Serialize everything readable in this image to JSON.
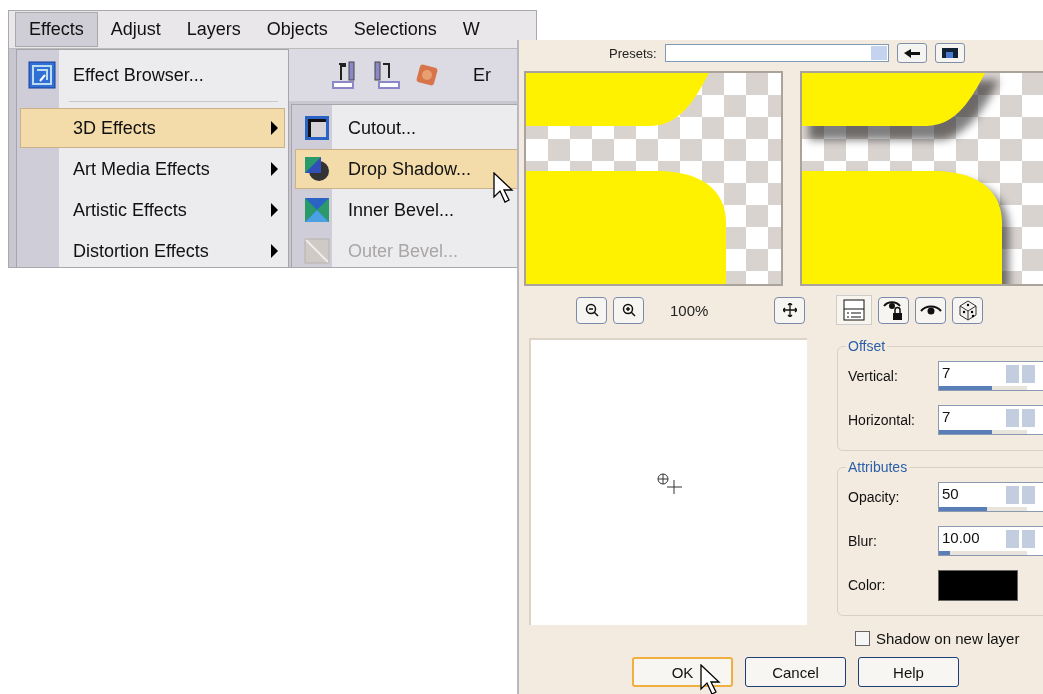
{
  "menu_bar": {
    "items": [
      {
        "label": "Effects",
        "selected": true
      },
      {
        "label": "Adjust",
        "selected": false
      },
      {
        "label": "Layers",
        "selected": false
      },
      {
        "label": "Objects",
        "selected": false
      },
      {
        "label": "Selections",
        "selected": false
      },
      {
        "label": "W",
        "selected": false
      }
    ]
  },
  "toolbar": {
    "text": "Er"
  },
  "effects_menu": {
    "items": [
      {
        "kind": "item",
        "label": "Effect Browser...",
        "selected": false,
        "submenu": false
      },
      {
        "kind": "separator"
      },
      {
        "kind": "item",
        "label": "3D Effects",
        "selected": true,
        "submenu": true
      },
      {
        "kind": "item",
        "label": "Art Media Effects",
        "selected": false,
        "submenu": true
      },
      {
        "kind": "item",
        "label": "Artistic Effects",
        "selected": false,
        "submenu": true
      },
      {
        "kind": "item",
        "label": "Distortion Effects",
        "selected": false,
        "submenu": true
      }
    ]
  },
  "submenu": {
    "items": [
      {
        "label": "Cutout...",
        "selected": false,
        "disabled": false
      },
      {
        "label": "Drop Shadow...",
        "selected": true,
        "disabled": false
      },
      {
        "label": "Inner Bevel...",
        "selected": false,
        "disabled": false
      },
      {
        "label": "Outer Bevel...",
        "selected": false,
        "disabled": true
      }
    ]
  },
  "dialog": {
    "presets_label": "Presets:",
    "zoom": "100%",
    "offset": {
      "title": "Offset",
      "fields": [
        {
          "label": "Vertical:",
          "value": "7",
          "level": 0.6
        },
        {
          "label": "Horizontal:",
          "value": "7",
          "level": 0.6
        }
      ]
    },
    "attributes": {
      "title": "Attributes",
      "fields": [
        {
          "label": "Opacity:",
          "value": "50",
          "level": 0.55
        },
        {
          "label": "Blur:",
          "value": "10.00",
          "level": 0.12
        }
      ],
      "color_label": "Color:",
      "color": "#000000"
    },
    "shadow_on_new_layer": {
      "label": "Shadow on new layer",
      "checked": false
    },
    "buttons": [
      {
        "label": "OK",
        "default": true
      },
      {
        "label": "Cancel",
        "default": false
      },
      {
        "label": "Help",
        "default": false
      }
    ]
  }
}
